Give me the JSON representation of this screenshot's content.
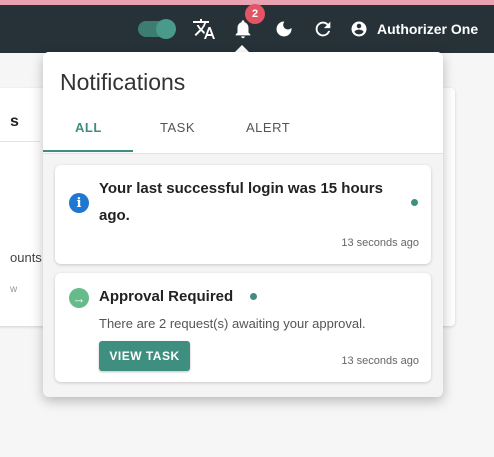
{
  "topbar": {
    "user_name": "Authorizer One",
    "notification_count": "2",
    "theme_toggle_on": true
  },
  "background": {
    "card_title_fragment": "s",
    "card_text_fragment": "ounts",
    "card_subtext_fragment": "w"
  },
  "notifications_panel": {
    "title": "Notifications",
    "tabs": [
      {
        "label": "ALL",
        "active": true
      },
      {
        "label": "TASK",
        "active": false
      },
      {
        "label": "ALERT",
        "active": false
      }
    ],
    "items": [
      {
        "icon": "info-icon",
        "icon_glyph": "i",
        "title": "Your last successful login was 15 hours ago.",
        "body": "",
        "time": "13 seconds ago",
        "unread": true
      },
      {
        "icon": "arrow-right-circle-icon",
        "icon_glyph": "→",
        "title": "Approval Required",
        "body": "There are 2 request(s) awaiting your approval.",
        "action_label": "VIEW TASK",
        "time": "13 seconds ago",
        "unread": true
      }
    ]
  },
  "colors": {
    "topbar": "#263238",
    "accent": "#3f8f80",
    "badge": "#e25565",
    "info": "#1e78d2",
    "success": "#66bb8a"
  }
}
